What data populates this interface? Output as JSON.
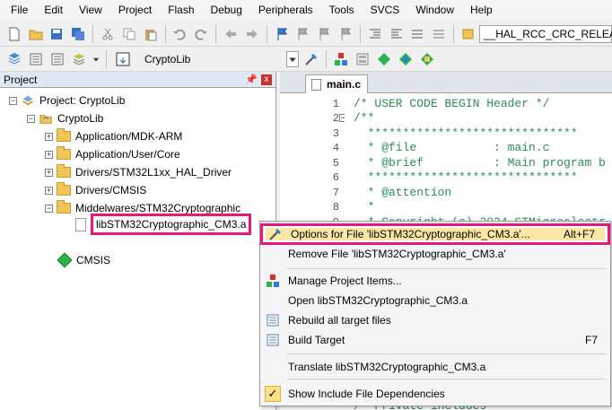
{
  "menu": [
    "File",
    "Edit",
    "View",
    "Project",
    "Flash",
    "Debug",
    "Peripherals",
    "Tools",
    "SVCS",
    "Window",
    "Help"
  ],
  "toolbar": {
    "search_combo": "__HAL_RCC_CRC_RELEAS",
    "target_combo": "CryptoLib",
    "load_label": "LOAD"
  },
  "project_panel": {
    "title": "Project",
    "pin": "ᛘ",
    "close": "x",
    "tree": {
      "root": "Project: CryptoLib",
      "target": "CryptoLib",
      "groups": [
        "Application/MDK-ARM",
        "Application/User/Core",
        "Drivers/STM32L1xx_HAL_Driver",
        "Drivers/CMSIS",
        "Middelwares/STM32Cryptographic"
      ],
      "selected_file": "libSTM32Cryptographic_CM3.a",
      "cmsis": "CMSIS"
    }
  },
  "editor": {
    "tab": "main.c",
    "lines": [
      {
        "n": "1",
        "text": "/* USER CODE BEGIN Header */"
      },
      {
        "n": "2",
        "text": "/**"
      },
      {
        "n": "3",
        "text": "  ******************************"
      },
      {
        "n": "4",
        "text": "  * @file           : main.c"
      },
      {
        "n": "5",
        "text": "  * @brief          : Main program b"
      },
      {
        "n": "6",
        "text": "  ******************************"
      },
      {
        "n": "7",
        "text": "  * @attention"
      },
      {
        "n": "8",
        "text": "  *"
      },
      {
        "n": "9",
        "text": "  * Copyright (c) 2024 STMicroelectr"
      }
    ],
    "partial_bottom": "/* Private includes"
  },
  "context_menu": {
    "items": [
      {
        "label": "Options for File 'libSTM32Cryptographic_CM3.a'...",
        "shortcut": "Alt+F7"
      },
      {
        "label": "Remove File 'libSTM32Cryptographic_CM3.a'",
        "shortcut": ""
      },
      {
        "label": "Manage Project Items...",
        "shortcut": ""
      },
      {
        "label": "Open libSTM32Cryptographic_CM3.a",
        "shortcut": ""
      },
      {
        "label": "Rebuild all target files",
        "shortcut": ""
      },
      {
        "label": "Build Target",
        "shortcut": "F7"
      },
      {
        "label": "Translate libSTM32Cryptographic_CM3.a",
        "shortcut": ""
      },
      {
        "label": "Show Include File Dependencies",
        "shortcut": ""
      }
    ],
    "checkmark": "✓"
  },
  "colors": {
    "highlight_border": "#e8187d",
    "comment": "#2e8b57"
  }
}
